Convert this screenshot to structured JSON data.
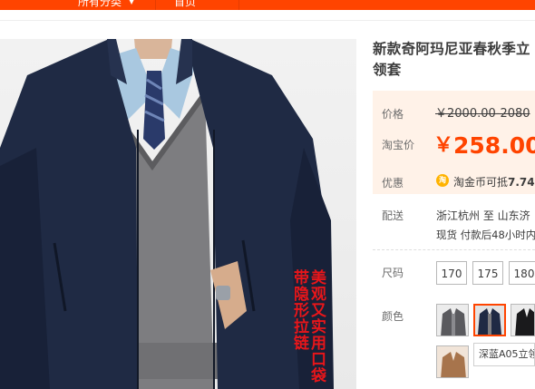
{
  "nav": {
    "category_label": "所有分类",
    "home_label": "首页"
  },
  "image": {
    "promo_text": "美观又实用口袋带隐形拉链"
  },
  "product": {
    "title": "新款奇阿玛尼亚春秋季立领套",
    "price_label": "价格",
    "original_price": "￥2000.00-2080",
    "taobao_price_label": "淘宝价",
    "currency": "￥",
    "sale_price": "258.00",
    "discount_label": "优惠",
    "coin_icon_glyph": "淘",
    "coin_text_prefix": "淘金币可抵",
    "coin_text_amount": "7.74",
    "shipping_label": "配送",
    "shipping_route": "浙江杭州 至  山东济",
    "shipping_note": "现货 付款后48小时内",
    "size_label": "尺码",
    "sizes": [
      "170",
      "175",
      "180"
    ],
    "color_label": "颜色",
    "selected_color_tooltip": "深蓝A05立领"
  },
  "colors": {
    "accent": "#ff4400",
    "price_bg": "#fff2e8",
    "promo_red": "#e8161a",
    "jacket_navy": "#1f2a44"
  }
}
